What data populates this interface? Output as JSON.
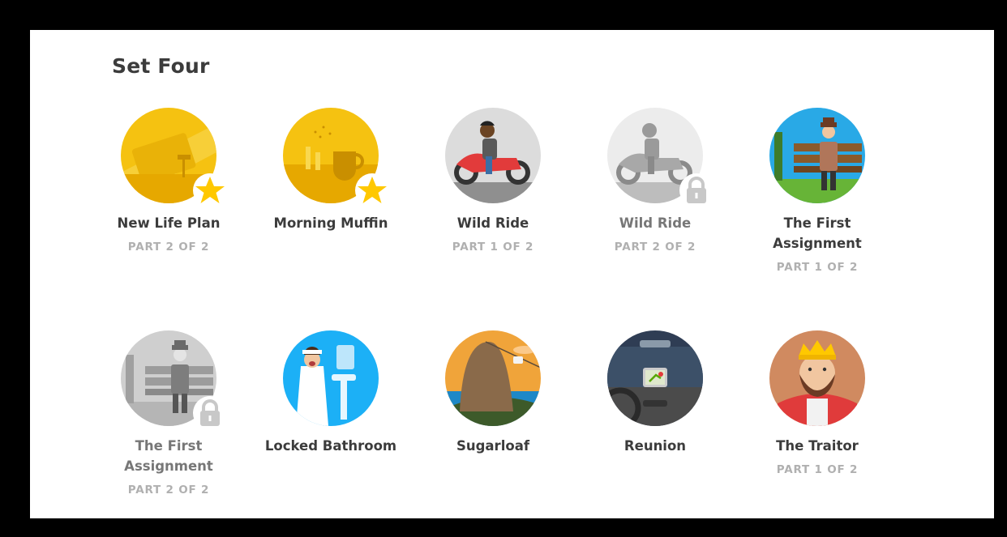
{
  "set": {
    "title": "Set Four"
  },
  "stories": [
    {
      "name": "New Life Plan",
      "part": "PART 2 OF 2",
      "icon": "golden-card-icon",
      "state": "completed"
    },
    {
      "name": "Morning Muffin",
      "part": "",
      "icon": "golden-cup-icon",
      "state": "completed"
    },
    {
      "name": "Wild Ride",
      "part": "PART 1 OF 2",
      "icon": "motorcycle-rider-icon",
      "state": "available"
    },
    {
      "name": "Wild Ride",
      "part": "PART 2 OF 2",
      "icon": "motorcycle-rider-icon",
      "state": "locked"
    },
    {
      "name": "The First\nAssignment",
      "part": "PART 1 OF 2",
      "icon": "man-on-bench-icon",
      "state": "available"
    },
    {
      "name": "The First\nAssignment",
      "part": "PART 2 OF 2",
      "icon": "man-on-bench-icon",
      "state": "locked"
    },
    {
      "name": "Locked Bathroom",
      "part": "",
      "icon": "bathroom-woman-icon",
      "state": "available"
    },
    {
      "name": "Sugarloaf",
      "part": "",
      "icon": "sugarloaf-mountain-icon",
      "state": "available"
    },
    {
      "name": "Reunion",
      "part": "",
      "icon": "car-dashboard-icon",
      "state": "available"
    },
    {
      "name": "The Traitor",
      "part": "PART 1 OF 2",
      "icon": "king-icon",
      "state": "available"
    }
  ],
  "colors": {
    "gold": "#f5c211",
    "star": "#ffc800",
    "lock": "#c8c8c8",
    "title": "#3c3c3c",
    "part": "#b0b0b0"
  }
}
